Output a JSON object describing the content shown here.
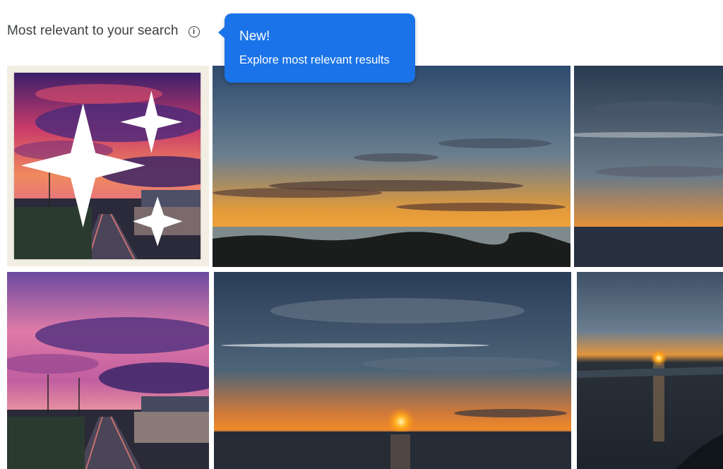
{
  "header": {
    "title": "Most relevant to your search",
    "info_icon": "info-icon"
  },
  "tooltip": {
    "title": "New!",
    "body": "Explore most relevant results",
    "background": "#1a73e8"
  },
  "results": [
    {
      "name": "image-result-1",
      "badge_icon": "sparkle-icon"
    },
    {
      "name": "image-result-2"
    },
    {
      "name": "image-result-3"
    },
    {
      "name": "image-result-4"
    },
    {
      "name": "image-result-5"
    },
    {
      "name": "image-result-6"
    }
  ]
}
